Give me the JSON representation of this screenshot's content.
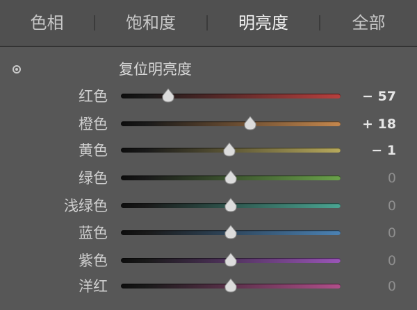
{
  "tabs": [
    {
      "label": "色相",
      "active": false
    },
    {
      "label": "饱和度",
      "active": false
    },
    {
      "label": "明亮度",
      "active": true
    },
    {
      "label": "全部",
      "active": false
    }
  ],
  "panel": {
    "reset_label": "复位明亮度",
    "icons": {
      "adjust": "target-adjust-icon"
    },
    "sliders": [
      {
        "key": "red",
        "label": "红色",
        "value": -57,
        "display": "− 57",
        "color": "#b8403e"
      },
      {
        "key": "orange",
        "label": "橙色",
        "value": 18,
        "display": "+ 18",
        "color": "#c5874d"
      },
      {
        "key": "yellow",
        "label": "黄色",
        "value": -1,
        "display": "− 1",
        "color": "#b7a95c"
      },
      {
        "key": "green",
        "label": "绿色",
        "value": 0,
        "display": "0",
        "color": "#6aa24a"
      },
      {
        "key": "aqua",
        "label": "浅绿色",
        "value": 0,
        "display": "0",
        "color": "#4aa592"
      },
      {
        "key": "blue",
        "label": "蓝色",
        "value": 0,
        "display": "0",
        "color": "#4b82b4"
      },
      {
        "key": "purple",
        "label": "紫色",
        "value": 0,
        "display": "0",
        "color": "#9a55b8"
      },
      {
        "key": "magenta",
        "label": "洋红",
        "value": 0,
        "display": "0",
        "color": "#b04f8a"
      }
    ],
    "range": [
      -100,
      100
    ]
  }
}
